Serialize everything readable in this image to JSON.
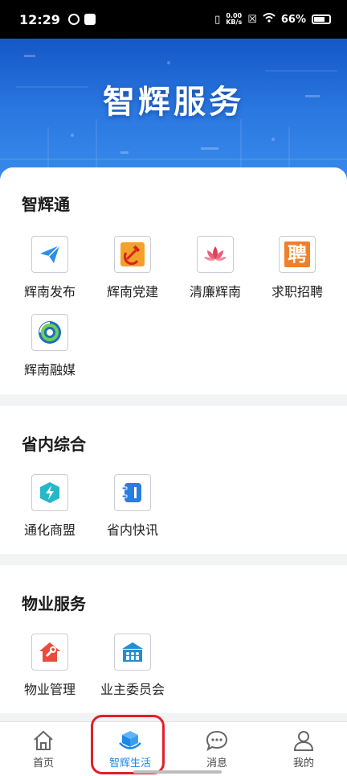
{
  "status_bar": {
    "time": "12:29",
    "net_speed_value": "0.00",
    "net_speed_unit": "KB/s",
    "battery": "66%"
  },
  "banner": {
    "title": "智辉服务"
  },
  "sections": [
    {
      "title": "智辉通",
      "items": [
        {
          "label": "辉南发布",
          "icon": "paper-plane-icon"
        },
        {
          "label": "辉南党建",
          "icon": "hammer-sickle-icon"
        },
        {
          "label": "清廉辉南",
          "icon": "lotus-icon"
        },
        {
          "label": "求职招聘",
          "icon": "recruit-glyph-icon"
        },
        {
          "label": "辉南融媒",
          "icon": "media-swirl-icon"
        }
      ]
    },
    {
      "title": "省内综合",
      "items": [
        {
          "label": "通化商盟",
          "icon": "lightning-badge-icon"
        },
        {
          "label": "省内快讯",
          "icon": "notebook-icon"
        }
      ]
    },
    {
      "title": "物业服务",
      "items": [
        {
          "label": "物业管理",
          "icon": "house-wrench-icon"
        },
        {
          "label": "业主委员会",
          "icon": "committee-building-icon"
        }
      ]
    }
  ],
  "recruit_glyph": "聘",
  "tabs": [
    {
      "label": "首页",
      "icon": "home-icon",
      "active": false
    },
    {
      "label": "智辉生活",
      "icon": "cube-hand-icon",
      "active": true
    },
    {
      "label": "消息",
      "icon": "chat-bubble-icon",
      "active": false
    },
    {
      "label": "我的",
      "icon": "person-icon",
      "active": false
    }
  ],
  "colors": {
    "accent": "#1e88e5",
    "highlight_box": "#e0202a",
    "banner": "#2a78e0"
  }
}
